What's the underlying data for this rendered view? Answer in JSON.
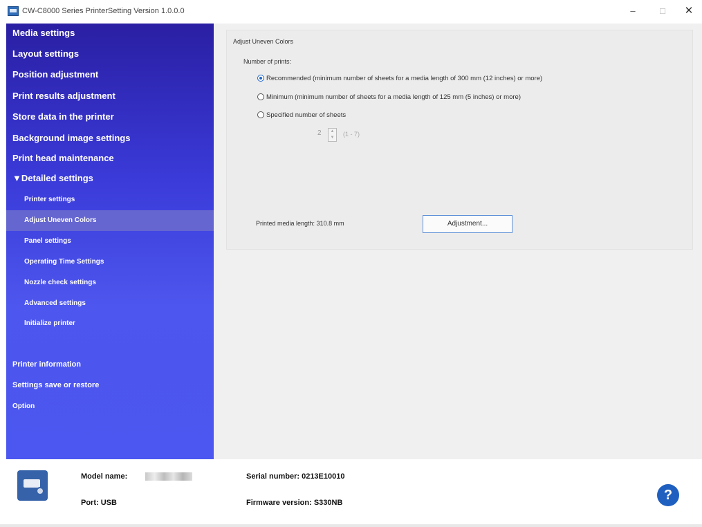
{
  "window": {
    "title": "CW-C8000 Series PrinterSetting Version 1.0.0.0",
    "minimize": "–",
    "maximize": "□",
    "close": "✕"
  },
  "sidebar": {
    "items": [
      {
        "label": "Media settings"
      },
      {
        "label": "Layout settings"
      },
      {
        "label": "Position adjustment"
      },
      {
        "label": "Print results adjustment"
      },
      {
        "label": "Store data in the printer"
      },
      {
        "label": "Background image settings"
      },
      {
        "label": "Print head maintenance"
      },
      {
        "label": "▼Detailed settings"
      },
      {
        "label": "Printer settings"
      },
      {
        "label": "Adjust Uneven Colors"
      },
      {
        "label": "Panel settings"
      },
      {
        "label": "Operating Time Settings"
      },
      {
        "label": "Nozzle check settings"
      },
      {
        "label": "Advanced settings"
      },
      {
        "label": "Initialize printer"
      },
      {
        "label": "Printer information"
      },
      {
        "label": "Settings save or restore"
      },
      {
        "label": "Option"
      }
    ],
    "selected": "Adjust Uneven Colors"
  },
  "main": {
    "section_title": "Adjust Uneven Colors",
    "number_of_prints_label": "Number of prints:",
    "options": [
      {
        "label": "Recommended (minimum number of sheets for a media length of 300 mm (12 inches) or more)",
        "selected": true
      },
      {
        "label": "Minimum (minimum number of sheets for a media length of 125 mm (5 inches) or more)",
        "selected": false
      },
      {
        "label": "Specified number of sheets",
        "selected": false
      }
    ],
    "spinner_value": "2",
    "spinner_range": "(1 - 7)",
    "printed_media_length_label": "Printed media length: 310.8 mm",
    "adjustment_button": "Adjustment..."
  },
  "footer": {
    "model_name_label": "Model name:",
    "port_label": "Port: USB",
    "serial_number_label": "Serial number: 0213E10010",
    "firmware_label": "Firmware version: S330NB",
    "help_icon": "?"
  },
  "colors": {
    "sidebar_top": "#2a1fa3",
    "sidebar_bottom": "#4b57f0",
    "selected_item": "#6566d0",
    "help_button": "#1f5fbf",
    "radio_accent": "#1f66c7"
  }
}
